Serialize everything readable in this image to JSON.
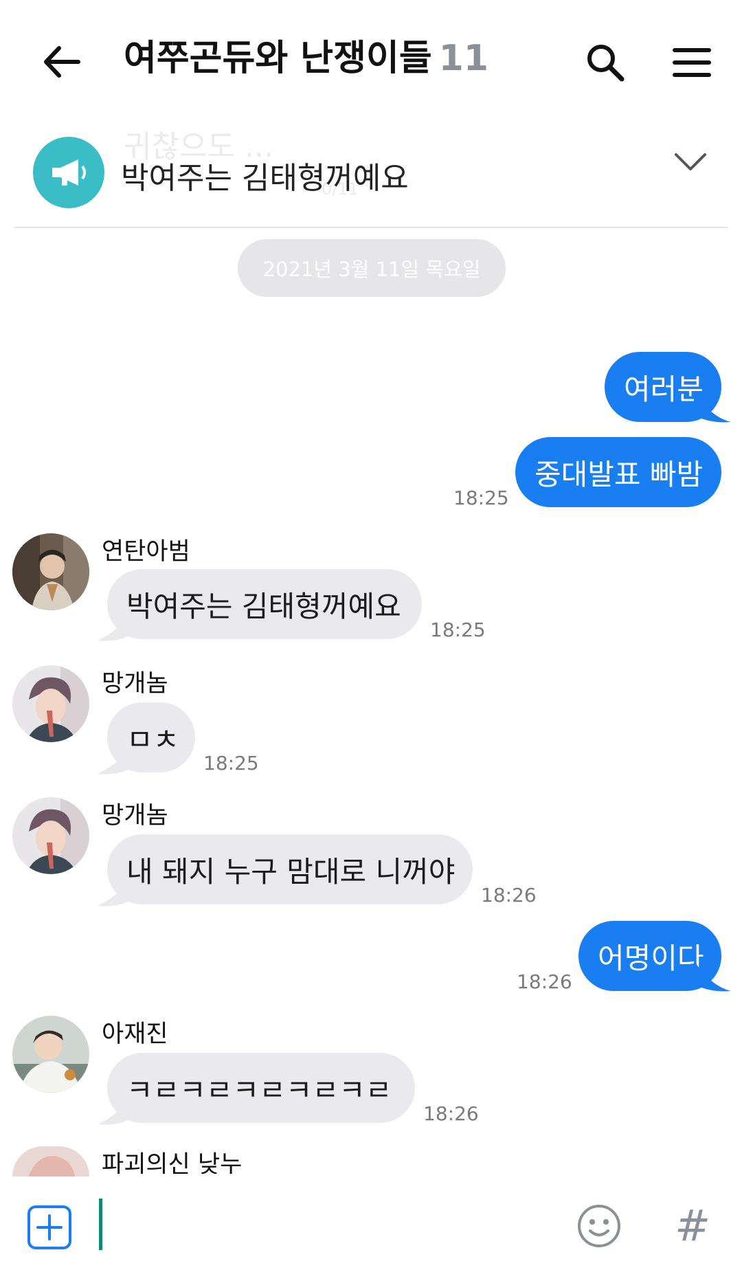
{
  "header": {
    "title": "여쭈곤듀와 난쟁이들",
    "member_count": "11",
    "back_icon": "arrow-left-icon",
    "search_icon": "search-icon",
    "menu_icon": "menu-icon"
  },
  "notice": {
    "text": "박여주는 김태형꺼예요",
    "faded_text": "귀찮으도 ...",
    "faded_sub": "0/11",
    "icon": "megaphone-icon",
    "expand_icon": "chevron-down-icon"
  },
  "date_separator": "2021년 3월 11일 목요일",
  "messages": [
    {
      "side": "mine",
      "text": "여러분",
      "time": ""
    },
    {
      "side": "mine",
      "text": "중대발표 빠밤",
      "time": "18:25"
    },
    {
      "side": "theirs",
      "sender": "연탄아범",
      "text": "박여주는 김태형꺼예요",
      "time": "18:25"
    },
    {
      "side": "theirs",
      "sender": "망개놈",
      "text": "ㅁㅊ",
      "time": "18:25"
    },
    {
      "side": "theirs",
      "sender": "망개놈",
      "text": "내 돼지 누구 맘대로 니꺼야",
      "time": "18:26"
    },
    {
      "side": "mine",
      "text": "어명이다",
      "time": "18:26"
    },
    {
      "side": "theirs",
      "sender": "아재진",
      "text": "ㅋㄹㅋㄹㅋㄹㅋㄹㅋㄹ",
      "time": "18:26"
    },
    {
      "side": "theirs",
      "sender": "파괴의신 낮누",
      "text": "",
      "time": ""
    }
  ],
  "input": {
    "add_icon": "plus-square-icon",
    "emoji_icon": "smiley-icon",
    "hashtag_icon": "hashtag-icon",
    "hashtag_symbol": "#"
  },
  "colors": {
    "mine_bubble": "#1a7ef3",
    "theirs_bubble": "#e9e9ee",
    "notice_icon_bg": "#3bbdc8",
    "cursor": "#0d8a77",
    "accent_blue": "#1a7ef3"
  }
}
